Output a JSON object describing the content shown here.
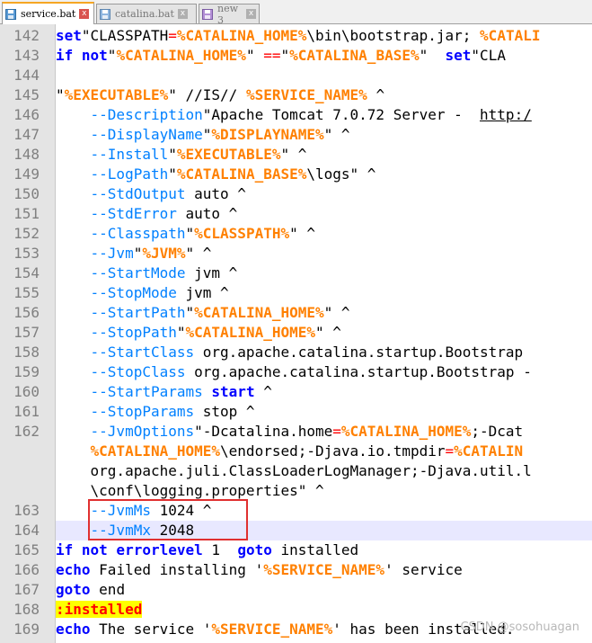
{
  "tabs": [
    {
      "label": "service.bat",
      "active": true,
      "close": "x"
    },
    {
      "label": "catalina.bat",
      "active": false,
      "close": "x"
    },
    {
      "label": "new 3",
      "active": false,
      "close": "x"
    }
  ],
  "watermark": "CSDN @sosohuagan",
  "lines": [
    {
      "n": "142",
      "parts": [
        [
          "kw",
          "set"
        ],
        [
          "",
          "\"CLASSPATH"
        ],
        [
          "op",
          "="
        ],
        [
          "var",
          "%CATALINA_HOME%"
        ],
        [
          "",
          "\\bin\\bootstrap.jar;"
        ],
        [
          "var",
          "%CATALI"
        ]
      ]
    },
    {
      "n": "143",
      "parts": [
        [
          "kw",
          "if not"
        ],
        [
          "",
          "\""
        ],
        [
          "var",
          "%CATALINA_HOME%"
        ],
        [
          "",
          "\" "
        ],
        [
          "op",
          "=="
        ],
        [
          "",
          "\""
        ],
        [
          "var",
          "%CATALINA_BASE%"
        ],
        [
          "",
          "\" "
        ],
        [
          "kw",
          "set"
        ],
        [
          "",
          "\"CLA"
        ]
      ]
    },
    {
      "n": "144",
      "parts": []
    },
    {
      "n": "145",
      "parts": [
        [
          "",
          "\""
        ],
        [
          "var",
          "%EXECUTABLE%"
        ],
        [
          "",
          "\" //IS//"
        ],
        [
          "var",
          "%SERVICE_NAME%"
        ],
        [
          "",
          "^"
        ]
      ]
    },
    {
      "n": "146",
      "parts": [
        [
          "",
          "    "
        ],
        [
          "opt",
          "--Description"
        ],
        [
          "",
          "\"Apache Tomcat 7.0.72 Server - "
        ],
        [
          "link",
          "http:/"
        ]
      ]
    },
    {
      "n": "147",
      "parts": [
        [
          "",
          "    "
        ],
        [
          "opt",
          "--DisplayName"
        ],
        [
          "",
          "\""
        ],
        [
          "var",
          "%DISPLAYNAME%"
        ],
        [
          "",
          "\" ^"
        ]
      ]
    },
    {
      "n": "148",
      "parts": [
        [
          "",
          "    "
        ],
        [
          "opt",
          "--Install"
        ],
        [
          "",
          "\""
        ],
        [
          "var",
          "%EXECUTABLE%"
        ],
        [
          "",
          "\" ^"
        ]
      ]
    },
    {
      "n": "149",
      "parts": [
        [
          "",
          "    "
        ],
        [
          "opt",
          "--LogPath"
        ],
        [
          "",
          "\""
        ],
        [
          "var",
          "%CATALINA_BASE%"
        ],
        [
          "",
          "\\logs\" ^"
        ]
      ]
    },
    {
      "n": "150",
      "parts": [
        [
          "",
          "    "
        ],
        [
          "opt",
          "--StdOutput"
        ],
        [
          "",
          "auto ^"
        ]
      ]
    },
    {
      "n": "151",
      "parts": [
        [
          "",
          "    "
        ],
        [
          "opt",
          "--StdError"
        ],
        [
          "",
          "auto ^"
        ]
      ]
    },
    {
      "n": "152",
      "parts": [
        [
          "",
          "    "
        ],
        [
          "opt",
          "--Classpath"
        ],
        [
          "",
          "\""
        ],
        [
          "var",
          "%CLASSPATH%"
        ],
        [
          "",
          "\" ^"
        ]
      ]
    },
    {
      "n": "153",
      "parts": [
        [
          "",
          "    "
        ],
        [
          "opt",
          "--Jvm"
        ],
        [
          "",
          "\""
        ],
        [
          "var",
          "%JVM%"
        ],
        [
          "",
          "\" ^"
        ]
      ]
    },
    {
      "n": "154",
      "parts": [
        [
          "",
          "    "
        ],
        [
          "opt",
          "--StartMode"
        ],
        [
          "",
          "jvm ^"
        ]
      ]
    },
    {
      "n": "155",
      "parts": [
        [
          "",
          "    "
        ],
        [
          "opt",
          "--StopMode"
        ],
        [
          "",
          "jvm ^"
        ]
      ]
    },
    {
      "n": "156",
      "parts": [
        [
          "",
          "    "
        ],
        [
          "opt",
          "--StartPath"
        ],
        [
          "",
          "\""
        ],
        [
          "var",
          "%CATALINA_HOME%"
        ],
        [
          "",
          "\" ^"
        ]
      ]
    },
    {
      "n": "157",
      "parts": [
        [
          "",
          "    "
        ],
        [
          "opt",
          "--StopPath"
        ],
        [
          "",
          "\""
        ],
        [
          "var",
          "%CATALINA_HOME%"
        ],
        [
          "",
          "\" ^"
        ]
      ]
    },
    {
      "n": "158",
      "parts": [
        [
          "",
          "    "
        ],
        [
          "opt",
          "--StartClass"
        ],
        [
          "",
          "org.apache.catalina.startup.Bootstrap"
        ]
      ]
    },
    {
      "n": "159",
      "parts": [
        [
          "",
          "    "
        ],
        [
          "opt",
          "--StopClass"
        ],
        [
          "",
          "org.apache.catalina.startup.Bootstrap -"
        ]
      ]
    },
    {
      "n": "160",
      "parts": [
        [
          "",
          "    "
        ],
        [
          "opt",
          "--StartParams"
        ],
        [
          "kw",
          "start"
        ],
        [
          "",
          "^"
        ]
      ]
    },
    {
      "n": "161",
      "parts": [
        [
          "",
          "    "
        ],
        [
          "opt",
          "--StopParams"
        ],
        [
          "",
          "stop ^"
        ]
      ]
    },
    {
      "n": "162",
      "parts": [
        [
          "",
          "    "
        ],
        [
          "opt",
          "--JvmOptions"
        ],
        [
          "",
          "\"-Dcatalina.home"
        ],
        [
          "op",
          "="
        ],
        [
          "var",
          "%CATALINA_HOME%"
        ],
        [
          "",
          ";-Dcat"
        ]
      ]
    },
    {
      "n": "",
      "parts": [
        [
          "",
          "    "
        ],
        [
          "var",
          "%CATALINA_HOME%"
        ],
        [
          "",
          "\\endorsed;-Djava.io.tmpdir"
        ],
        [
          "op",
          "="
        ],
        [
          "var",
          "%CATALIN"
        ]
      ]
    },
    {
      "n": "",
      "parts": [
        [
          "",
          "    org.apache.juli.ClassLoaderLogManager;-Djava.util.l"
        ]
      ]
    },
    {
      "n": "",
      "parts": [
        [
          "",
          "    \\conf\\logging.properties\" ^"
        ]
      ]
    },
    {
      "n": "163",
      "parts": [
        [
          "",
          "    "
        ],
        [
          "opt",
          "--JvmMs"
        ],
        [
          "",
          "1024 ^"
        ]
      ]
    },
    {
      "n": "164",
      "current": true,
      "parts": [
        [
          "",
          "    "
        ],
        [
          "opt",
          "--JvmMx"
        ],
        [
          "",
          "2048"
        ]
      ]
    },
    {
      "n": "165",
      "parts": [
        [
          "kw",
          "if not errorlevel"
        ],
        [
          "",
          "1 "
        ],
        [
          "kw",
          "goto"
        ],
        [
          "",
          "installed"
        ]
      ]
    },
    {
      "n": "166",
      "parts": [
        [
          "kw",
          "echo"
        ],
        [
          "",
          "Failed installing '"
        ],
        [
          "var",
          "%SERVICE_NAME%"
        ],
        [
          "",
          "' service"
        ]
      ]
    },
    {
      "n": "167",
      "parts": [
        [
          "kw",
          "goto"
        ],
        [
          "",
          "end"
        ]
      ]
    },
    {
      "n": "168",
      "parts": [
        [
          "label",
          ":installed"
        ]
      ]
    },
    {
      "n": "169",
      "parts": [
        [
          "kw",
          "echo"
        ],
        [
          "",
          "The service '"
        ],
        [
          "var",
          "%SERVICE_NAME%"
        ],
        [
          "",
          "' has been installed."
        ]
      ]
    }
  ]
}
